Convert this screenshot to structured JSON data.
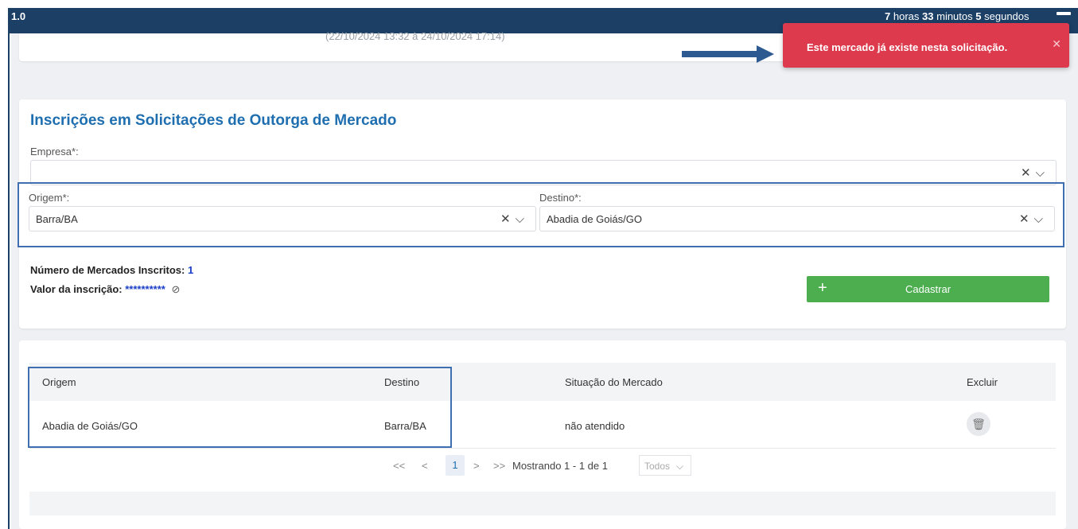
{
  "topbar": {
    "version": "1.0",
    "timer": {
      "hours": "7",
      "hours_label": "horas",
      "minutes": "33",
      "minutes_label": "minutos",
      "seconds": "5",
      "seconds_label": "segundos"
    }
  },
  "top_card": {
    "period": "(22/10/2024 13:32 à 24/10/2024 17:14)"
  },
  "form": {
    "title": "Inscrições em Solicitações de Outorga de Mercado",
    "empresa_label": "Empresa*:",
    "empresa_value": "",
    "origem_label": "Origem*:",
    "origem_value": "Barra/BA",
    "destino_label": "Destino*:",
    "destino_value": "Abadia de Goiás/GO",
    "mercados_label": "Número de Mercados Inscritos:",
    "mercados_count": "1",
    "valor_label": "Valor da inscrição:",
    "valor_mask": "**********",
    "cadastrar_label": "Cadastrar"
  },
  "table": {
    "headers": [
      "Origem",
      "Destino",
      "Situação do Mercado",
      "Excluir"
    ],
    "rows": [
      {
        "origem": "Abadia de Goiás/GO",
        "destino": "Barra/BA",
        "situacao": "não atendido"
      }
    ],
    "pager": {
      "first": "<<",
      "prev": "<",
      "page": "1",
      "next": ">",
      "last": ">>",
      "showing": "Mostrando 1 - 1 de 1",
      "per_page": "Todos"
    }
  },
  "toast": {
    "message": "Este mercado já existe nesta solicitação."
  },
  "icons": {
    "clear": "close-icon",
    "dropdown": "chevron-down-icon",
    "trash": "trash-icon",
    "eye": "eye-off-icon",
    "plus": "plus-icon"
  },
  "colors": {
    "brand": "#1c3f66",
    "title": "#1f6fb0",
    "success": "#4cae4f",
    "danger": "#dd3b4d",
    "highlight": "#3f6fb0"
  }
}
